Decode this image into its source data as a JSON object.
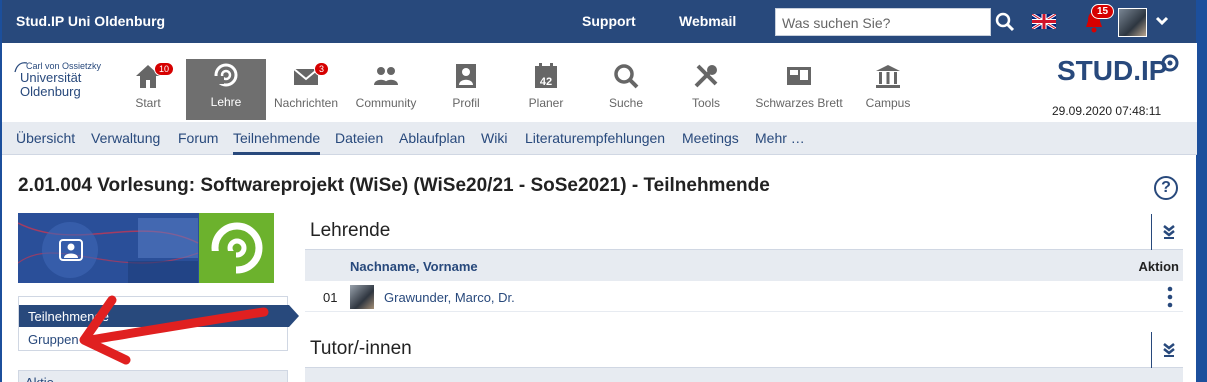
{
  "topbar": {
    "brand": "Stud.IP Uni Oldenburg",
    "links": [
      "Support",
      "Webmail"
    ],
    "search_placeholder": "Was suchen Sie?",
    "notifications_count": "15"
  },
  "navbar": {
    "uni_logo": {
      "line1": "Carl von Ossietzky",
      "line2": "Universität",
      "line3": "Oldenburg"
    },
    "items": [
      {
        "label": "Start",
        "icon": "home-icon",
        "badge": "10"
      },
      {
        "label": "Lehre",
        "icon": "lehre-icon",
        "badge": ""
      },
      {
        "label": "Nachrichten",
        "icon": "mail-icon",
        "badge": "3"
      },
      {
        "label": "Community",
        "icon": "community-icon",
        "badge": ""
      },
      {
        "label": "Profil",
        "icon": "profile-icon",
        "badge": ""
      },
      {
        "label": "Planer",
        "icon": "calendar-icon",
        "badge": ""
      },
      {
        "label": "Suche",
        "icon": "search-icon",
        "badge": ""
      },
      {
        "label": "Tools",
        "icon": "tools-icon",
        "badge": ""
      },
      {
        "label": "Schwarzes Brett",
        "icon": "board-icon",
        "badge": ""
      },
      {
        "label": "Campus",
        "icon": "campus-icon",
        "badge": ""
      }
    ],
    "calendar_day": "42",
    "studip_logo": "STUD.IP",
    "datetime": "29.09.2020 07:48:11"
  },
  "subnav": {
    "tabs": [
      "Übersicht",
      "Verwaltung",
      "Forum",
      "Teilnehmende",
      "Dateien",
      "Ablaufplan",
      "Wiki",
      "Literaturempfehlungen",
      "Meetings",
      "Mehr …"
    ],
    "active": "Teilnehmende"
  },
  "page": {
    "title": "2.01.004 Vorlesung: Softwareprojekt (WiSe) (WiSe20/21 - SoSe2021) - Teilnehmende",
    "help": "?"
  },
  "sidebar": {
    "items": [
      "Teilnehmende",
      "Gruppen"
    ],
    "actions_label": "Aktio"
  },
  "sections": [
    {
      "title": "Lehrende",
      "columns": {
        "name": "Nachname, Vorname",
        "action": "Aktion"
      },
      "rows": [
        {
          "num": "01",
          "name": "Grawunder, Marco, Dr."
        }
      ]
    },
    {
      "title": "Tutor/-innen"
    }
  ],
  "colors": {
    "primary": "#28497c",
    "badge": "#d60000",
    "lehre_green": "#6cb22d",
    "annotation": "#e02020"
  }
}
